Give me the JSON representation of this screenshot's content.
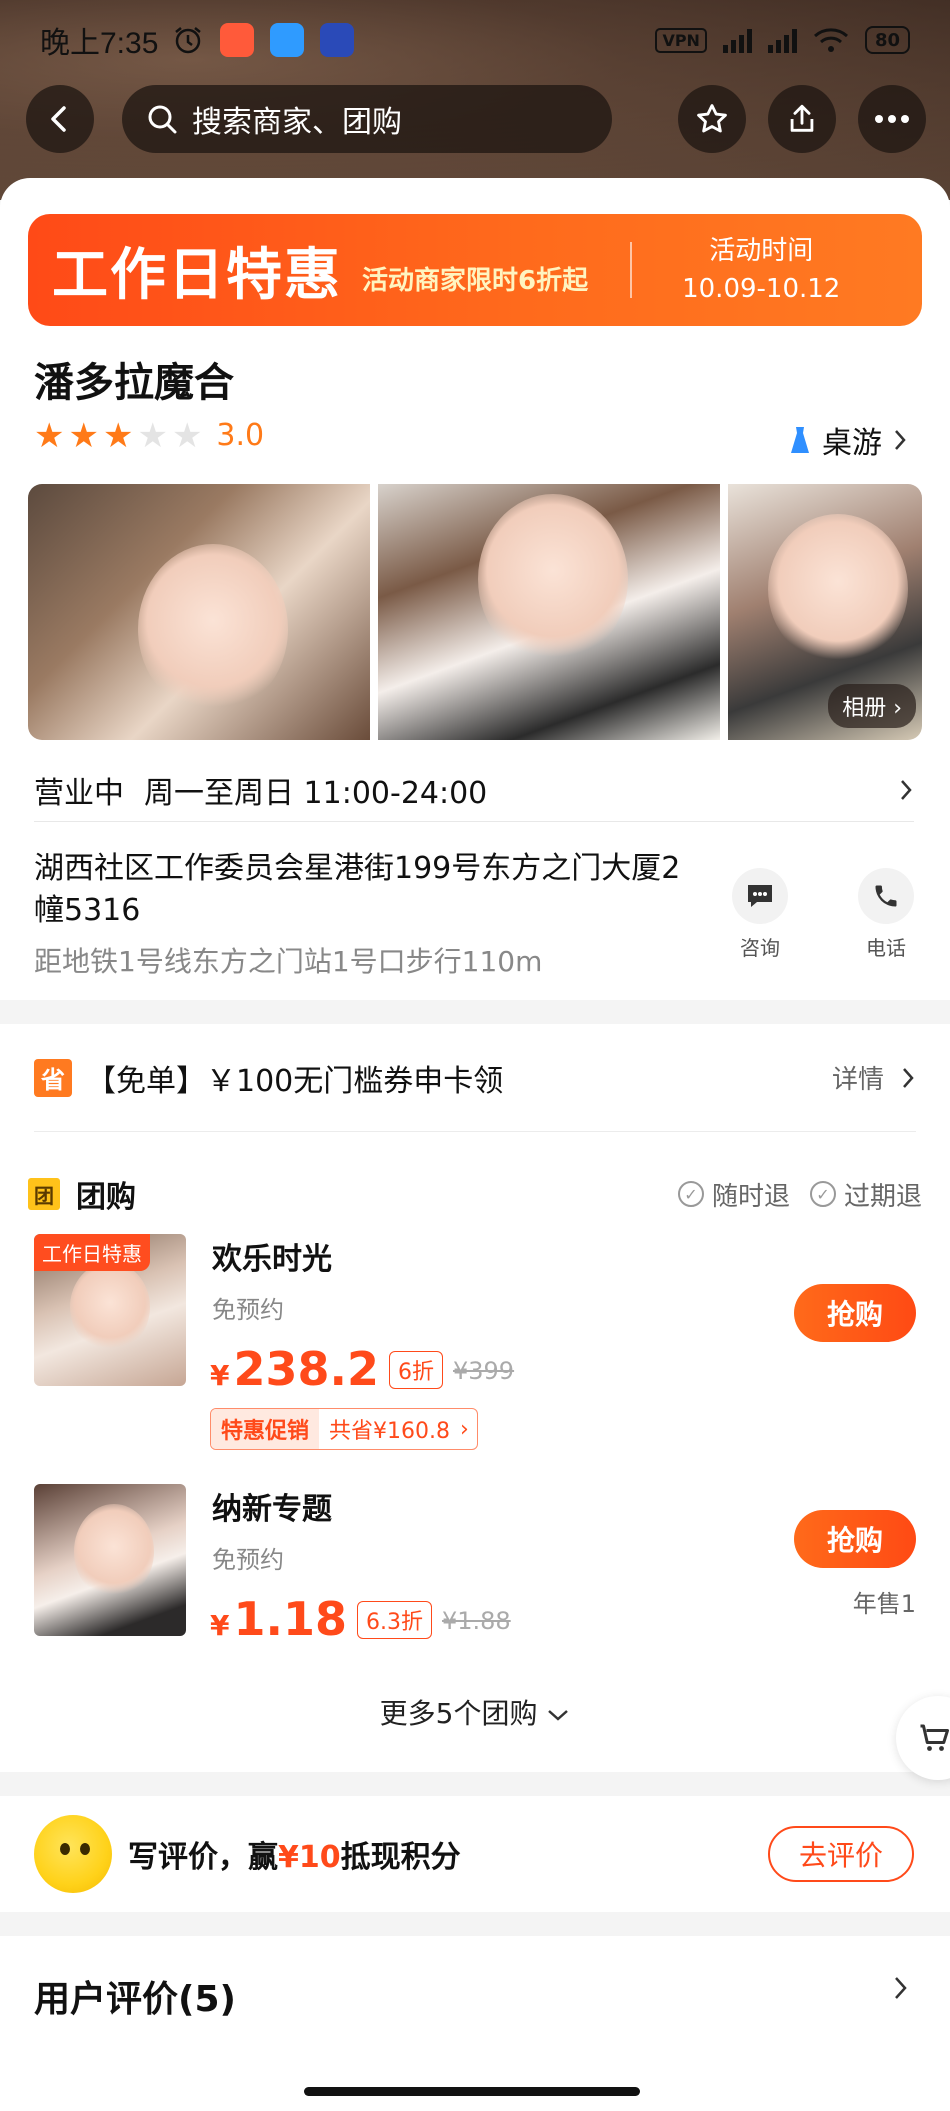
{
  "status_bar": {
    "time": "晚上7:35",
    "vpn": "VPN",
    "battery": "80"
  },
  "nav": {
    "search_placeholder": "搜索商家、团购"
  },
  "promo_banner": {
    "title": "工作日特惠",
    "subtitle": "活动商家限时6折起",
    "time_label": "活动时间",
    "time_range": "10.09-10.12"
  },
  "shop": {
    "name": "潘多拉魔合",
    "rating": "3.0",
    "stars_filled": 3,
    "stars_total": 5,
    "category": "桌游",
    "album_label": "相册",
    "status": "营业中",
    "hours": "周一至周日 11:00-24:00",
    "address": "湖西社区工作委员会星港街199号东方之门大厦2幢5316",
    "metro": "距地铁1号线东方之门站1号口步行110m",
    "consult_label": "咨询",
    "phone_label": "电话"
  },
  "coupon": {
    "badge": "省",
    "text": "【免单】￥100无门槛券申卡领",
    "detail": "详情"
  },
  "group_buy": {
    "badge": "团",
    "title": "团购",
    "guarantees": [
      "随时退",
      "过期退"
    ],
    "deals": [
      {
        "tag": "工作日特惠",
        "name": "欢乐时光",
        "sub": "免预约",
        "yen": "¥",
        "price": "238.2",
        "discount": "6折",
        "original": "¥399",
        "promo_label": "特惠促销",
        "promo_value": "共省¥160.8",
        "buy": "抢购",
        "sold": ""
      },
      {
        "tag": "",
        "name": "纳新专题",
        "sub": "免预约",
        "yen": "¥",
        "price": "1.18",
        "discount": "6.3折",
        "original": "¥1.88",
        "promo_label": "",
        "promo_value": "",
        "buy": "抢购",
        "sold": "年售1"
      }
    ],
    "more": "更多5个团购"
  },
  "review_promo": {
    "text_prefix": "写评价，赢",
    "highlight": "¥10",
    "text_suffix": "抵现积分",
    "button": "去评价"
  },
  "reviews": {
    "title": "用户评价(5)"
  },
  "colors": {
    "accent": "#ff4a1a",
    "star": "#ff7a18",
    "banner_start": "#ff4a17",
    "banner_end": "#ff7a22"
  }
}
